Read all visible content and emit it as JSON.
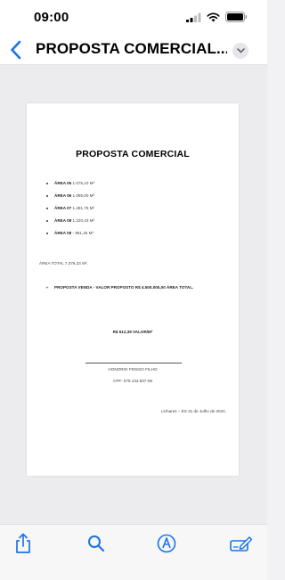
{
  "status_bar": {
    "time": "09:00"
  },
  "nav": {
    "title": "PROPOSTA COMERCIAL..."
  },
  "document": {
    "title": "PROPOSTA COMERCIAL",
    "areas": [
      {
        "label": "ÁREA 05",
        "value": " 1.075,10 M²"
      },
      {
        "label": "ÁREA 06",
        "value": " 1.095,00 M²"
      },
      {
        "label": "ÁREA 07",
        "value": " 1.481,75 M²"
      },
      {
        "label": "ÁREA 08",
        "value": " 1.220,43 M²"
      },
      {
        "label": "ÁREA 09",
        "value": " - 951,45 M²"
      }
    ],
    "total": "ÁREA TOTAL 7.376,23 M².",
    "proposal_arrow": "➢",
    "proposal": "PROPOSTA VENDA - VALOR PROPOSTO R$ 4.500.000,00 ÁREA TOTAL.",
    "price_per_m2": "R$ 612,39 VALOR/M²",
    "signer_name": "HONORIO FRISSO FILHO",
    "signer_cpf": "CPF: 075.134.837-08",
    "place_date": "Linhares – ES 31 de Julho de 2024."
  },
  "colors": {
    "accent": "#1a73e8"
  },
  "icons": {
    "nav": [
      "back-chevron-icon",
      "chevron-down-icon"
    ],
    "toolbar": [
      "share-icon",
      "search-icon",
      "markup-icon",
      "edit-form-icon"
    ]
  }
}
